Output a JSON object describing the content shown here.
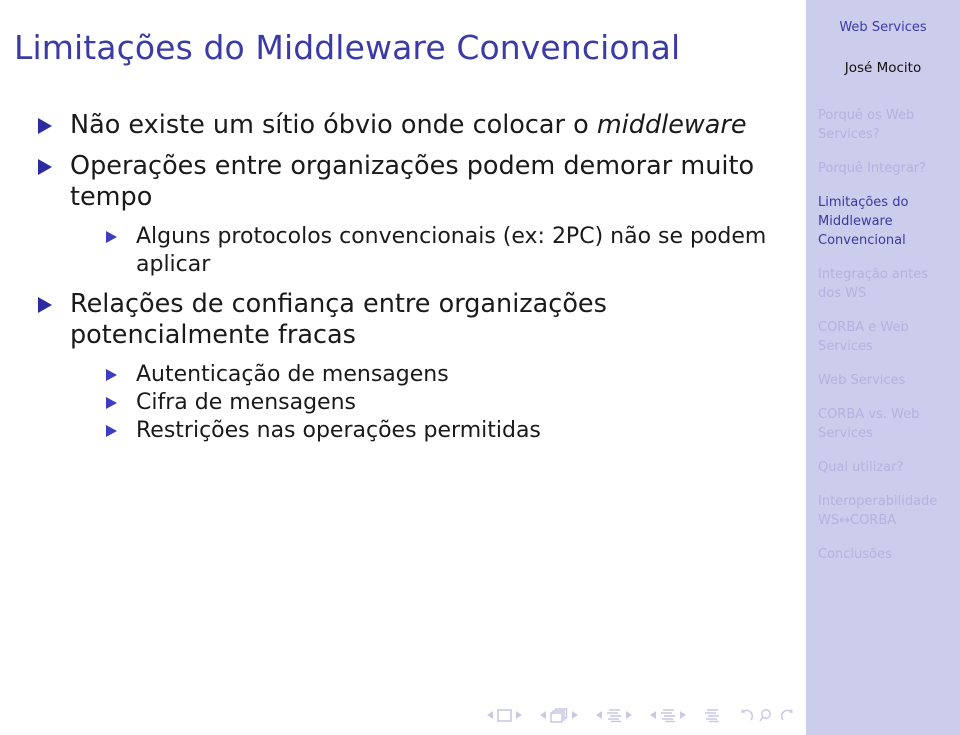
{
  "slide": {
    "title": "Limitações do Middleware Convencional"
  },
  "sidebar": {
    "title": "Web Services",
    "author": "José Mocito",
    "items": [
      {
        "label": "Porquê os Web Services?",
        "active": false
      },
      {
        "label": "Porquê Integrar?",
        "active": false
      },
      {
        "label": "Limitações do Middleware Convencional",
        "active": true
      },
      {
        "label": "Integração antes dos WS",
        "active": false
      },
      {
        "label": "CORBA e Web Services",
        "active": false
      },
      {
        "label": "Web Services",
        "active": false
      },
      {
        "label": "CORBA vs. Web Services",
        "active": false
      },
      {
        "label": "Qual utilizar?",
        "active": false
      },
      {
        "label": "Interoperabilidade WS↔CORBA",
        "active": false
      },
      {
        "label": "Conclusões",
        "active": false
      }
    ]
  },
  "content": {
    "bullets": [
      {
        "level": 1,
        "text_before": "Não existe um sítio óbvio onde colocar o ",
        "emphasis": "middleware",
        "text_after": ""
      },
      {
        "level": 1,
        "text_before": "Operações entre organizações podem demorar muito tempo",
        "emphasis": "",
        "text_after": ""
      },
      {
        "level": 2,
        "text_before": "Alguns protocolos convencionais (ex: 2PC) não se podem aplicar",
        "emphasis": "",
        "text_after": ""
      },
      {
        "level": 1,
        "text_before": "Relações de confiança entre organizações potencialmente fracas",
        "emphasis": "",
        "text_after": ""
      },
      {
        "level": 2,
        "text_before": "Autenticação de mensagens",
        "emphasis": "",
        "text_after": ""
      },
      {
        "level": 2,
        "text_before": "Cifra de mensagens",
        "emphasis": "",
        "text_after": ""
      },
      {
        "level": 2,
        "text_before": "Restrições nas operações permitidas",
        "emphasis": "",
        "text_after": ""
      }
    ]
  },
  "navbar": {
    "groups": [
      {
        "name": "frame",
        "icon": "frame-icon",
        "prev": "◀",
        "next": "▶"
      },
      {
        "name": "subsection",
        "icon": "stacked-frames-icon",
        "prev": "◀",
        "next": "▶"
      },
      {
        "name": "section",
        "icon": "section-lines-icon",
        "prev": "◀",
        "next": "▶"
      },
      {
        "name": "presentation",
        "icon": "document-lines-icon",
        "prev": "◀",
        "next": "▶"
      }
    ],
    "end_icon": "document-lines-icon",
    "history": [
      {
        "name": "back",
        "icon": "back-arrow-icon"
      },
      {
        "name": "find",
        "icon": "search-icon"
      },
      {
        "name": "forward",
        "icon": "forward-arrow-icon"
      }
    ]
  },
  "colors": {
    "title": "#3b3ba8",
    "sidebar_bg": "#ccccec",
    "sidebar_inactive": "#b3b3e0",
    "sidebar_active": "#3a3aa0",
    "bullet_l1": "#2c2ca0",
    "bullet_l2": "#3c3cc4",
    "nav_icon": "#c9c9e4"
  }
}
